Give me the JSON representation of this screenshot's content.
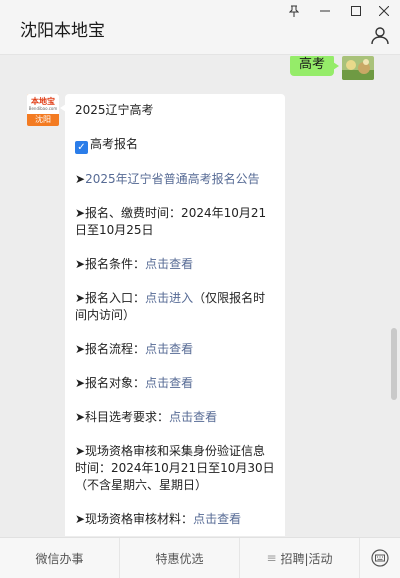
{
  "window": {
    "title": "沈阳本地宝",
    "controls": [
      "pin-icon",
      "minimize-icon",
      "maximize-icon",
      "close-icon"
    ]
  },
  "chat": {
    "outgoing": {
      "text": "高考"
    },
    "bot": {
      "avatar_brand": "本地宝",
      "avatar_sub": "Bendibao.com",
      "avatar_city": "沈阳"
    },
    "message": {
      "title": "2025辽宁高考",
      "section": "高考报名",
      "notice_link": "2025年辽宁省普通高考报名公告",
      "items": [
        {
          "label": "➤报名、缴费时间：2024年10月21日至10月25日"
        },
        {
          "label": "➤报名条件：",
          "link": "点击查看"
        },
        {
          "label": "➤报名入口：",
          "link": "点击进入",
          "suffix": "（仅限报名时间内访问）"
        },
        {
          "label": "➤报名流程：",
          "link": "点击查看"
        },
        {
          "label": "➤报名对象：",
          "link": "点击查看"
        },
        {
          "label": "➤科目选考要求：",
          "link": "点击查看"
        },
        {
          "label": "➤现场资格审核和采集身份验证信息时间：2024年10月21日至10月30日（不含星期六、星期日）"
        },
        {
          "label": "➤现场资格审核材料：",
          "link": "点击查看"
        }
      ]
    }
  },
  "bottom_menu": {
    "items": [
      "微信办事",
      "特惠优选",
      "招聘|活动"
    ],
    "menu_prefix": "≡",
    "keyboard_icon": "keyboard-icon"
  },
  "colors": {
    "link": "#576b95",
    "outgoing_bubble": "#95ec69",
    "check": "#2b7de9",
    "avatar": "#f37b22"
  }
}
